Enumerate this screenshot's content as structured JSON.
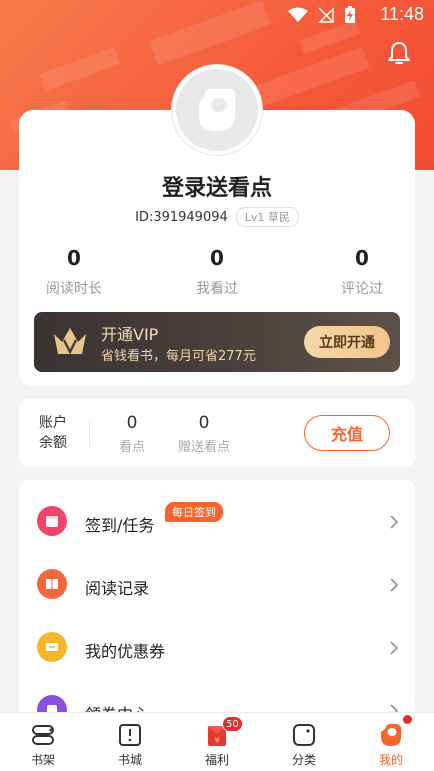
{
  "status_bar": {
    "time": "11:48"
  },
  "profile": {
    "title": "登录送看点",
    "id_text": "ID:391949094",
    "level": "Lv1 草民",
    "stats": [
      {
        "value": "0",
        "label": "阅读时长"
      },
      {
        "value": "0",
        "label": "我看过"
      },
      {
        "value": "0",
        "label": "评论过"
      }
    ]
  },
  "vip": {
    "title": "开通VIP",
    "subtitle": "省钱看书，每月可省277元",
    "button": "立即开通"
  },
  "balance": {
    "label_line1": "账户",
    "label_line2": "余额",
    "points_value": "0",
    "points_label": "看点",
    "gift_value": "0",
    "gift_label": "赠送看点",
    "recharge": "充值"
  },
  "menu": [
    {
      "label": "签到/任务",
      "badge": "每日签到",
      "icon": "checkin-icon",
      "color": "#f0436a"
    },
    {
      "label": "阅读记录",
      "icon": "reading-record-icon",
      "color": "#f2683c"
    },
    {
      "label": "我的优惠券",
      "icon": "coupon-icon",
      "color": "#f4b72a"
    },
    {
      "label": "领券中心",
      "icon": "coupon-center-icon",
      "color": "#8b4ee0"
    }
  ],
  "tabs": [
    {
      "label": "书架",
      "icon": "bookshelf-icon"
    },
    {
      "label": "书城",
      "icon": "bookstore-icon"
    },
    {
      "label": "福利",
      "icon": "red-envelope-icon",
      "badge": "50"
    },
    {
      "label": "分类",
      "icon": "category-icon"
    },
    {
      "label": "我的",
      "icon": "profile-icon",
      "active": true
    }
  ],
  "colors": {
    "accent": "#f5652d",
    "hero": "#f55a3a",
    "badge_red": "#e02d2d"
  }
}
